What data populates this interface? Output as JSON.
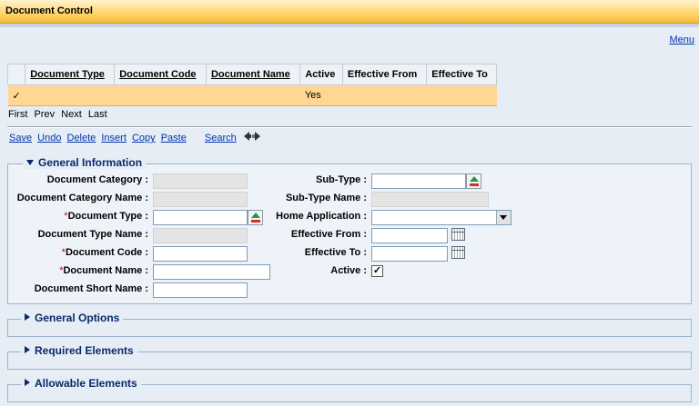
{
  "window": {
    "title": "Document Control",
    "menu_link": "Menu"
  },
  "grid": {
    "columns": [
      "Document Type",
      "Document Code",
      "Document Name",
      "Active",
      "Effective From",
      "Effective To"
    ],
    "rows": [
      {
        "selected_mark": "✓",
        "document_type": "",
        "document_code": "",
        "document_name": "",
        "active": "Yes",
        "effective_from": "",
        "effective_to": ""
      }
    ],
    "pager": [
      "First",
      "Prev",
      "Next",
      "Last"
    ]
  },
  "toolbar": {
    "save": "Save",
    "undo": "Undo",
    "delete": "Delete",
    "insert": "Insert",
    "copy": "Copy",
    "paste": "Paste",
    "search": "Search"
  },
  "general_information": {
    "legend": "General Information",
    "document_category_label": "Document Category :",
    "document_category_name_label": "Document Category Name :",
    "document_type_label": "Document Type :",
    "document_type_name_label": "Document Type Name :",
    "document_code_label": "Document Code :",
    "document_name_label": "Document Name :",
    "document_short_name_label": "Document Short Name :",
    "sub_type_label": "Sub-Type :",
    "sub_type_name_label": "Sub-Type Name :",
    "home_application_label": "Home Application :",
    "effective_from_label": "Effective From :",
    "effective_to_label": "Effective To :",
    "active_label": "Active :",
    "required_mark": "*",
    "active_checked": "✓"
  },
  "collapsed_sections": {
    "general_options": "General Options",
    "required_elements": "Required Elements",
    "allowable_elements": "Allowable Elements"
  },
  "colors": {
    "title_bar": "#ffd56b",
    "selected_row": "#ffd693",
    "link": "#0033aa",
    "section_legend": "#0a2a6a",
    "required": "#cc0000"
  }
}
